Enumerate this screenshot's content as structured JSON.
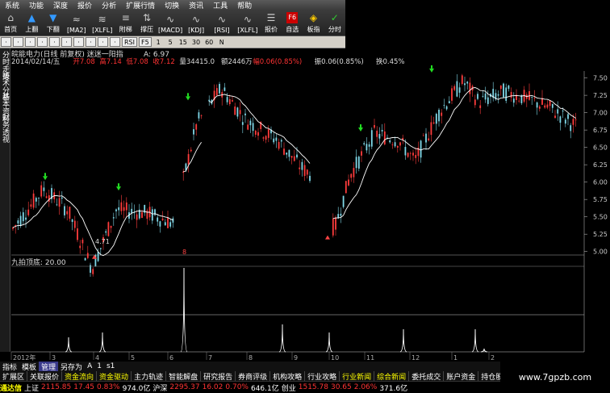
{
  "menubar": {
    "items": [
      "系统",
      "功能",
      "深度",
      "报价",
      "分析",
      "扩展行情",
      "切换",
      "资讯",
      "工具",
      "帮助"
    ]
  },
  "toolbar": {
    "buttons": [
      {
        "label": "首页",
        "icon": "home-icon"
      },
      {
        "label": "上翻",
        "icon": "arrow-up-icon"
      },
      {
        "label": "下翻",
        "icon": "arrow-down-icon"
      },
      {
        "label": "[MA2]",
        "icon": "ma-icon"
      },
      {
        "label": "[XLFL]",
        "icon": "xlfl-icon"
      },
      {
        "label": "附梯",
        "icon": "ladder-icon"
      },
      {
        "label": "撑压",
        "icon": "support-icon"
      },
      {
        "label": "[MACD]",
        "icon": "macd-icon"
      },
      {
        "label": "[KDJ]",
        "icon": "kdj-icon"
      },
      {
        "label": "[RSI]",
        "icon": "rsi-icon"
      },
      {
        "label": "[XLFL]",
        "icon": "xlfl2-icon"
      },
      {
        "label": "报价",
        "icon": "quote-icon"
      },
      {
        "label": "自选",
        "icon": "watchlist-icon"
      },
      {
        "label": "板指",
        "icon": "index-icon"
      },
      {
        "label": "分时",
        "icon": "intraday-icon"
      }
    ]
  },
  "toolbar2": {
    "items": [
      "RSI",
      "F5",
      "1",
      "5",
      "15",
      "30",
      "60",
      "N"
    ]
  },
  "info": {
    "title": "皖能电力(日线 前复权) 迷迷一阳指",
    "a_value": "A: 6.97",
    "date": "2014/02/14/五",
    "open": "开7.08",
    "high": "高7.14",
    "low": "低7.08",
    "close": "收7.12",
    "volume": "量34415.0",
    "amount": "额2446万",
    "change": "幅0.06(0.85%)",
    "amp": "振0.06(0.85%)",
    "turnover": "换0.45%"
  },
  "leftpanel": {
    "tabs": [
      "分时走势",
      "技术分析",
      "基本资料",
      "财务透视"
    ]
  },
  "chart_data": {
    "type": "line",
    "price_axis": [
      7.5,
      7.25,
      7.0,
      6.75,
      6.5,
      6.25,
      6.0,
      5.75,
      5.5,
      5.25,
      5.0
    ],
    "min_label": "4.71",
    "x_labels": [
      "2012年",
      "3",
      "4",
      "5",
      "6",
      "7",
      "8",
      "9",
      "10",
      "11",
      "12",
      "1",
      "2"
    ],
    "indicator_label": "九拍顶底: 20.00",
    "peaks": [
      "8"
    ]
  },
  "bottomtabs": {
    "items": [
      "指标",
      "模板",
      "管理",
      "另存为",
      "A",
      "1",
      "s1"
    ],
    "active": 2
  },
  "footer": {
    "items": [
      "扩展区",
      "关联报价",
      "资金流向",
      "资金驱动",
      "主力轨迹",
      "智能解盘",
      "研究报告",
      "券商评级",
      "机构攻略",
      "行业攻略",
      "行业新闻",
      "综合新闻",
      "委托成交",
      "账户资金",
      "持仓股份"
    ]
  },
  "status": {
    "app": "通达信",
    "index1_name": "上证",
    "index1_value": "2115.85",
    "index1_change": "17.45",
    "index1_pct": "0.83%",
    "index1_amount": "974.0亿",
    "index2_name": "沪深",
    "index2_value": "2295.37",
    "index2_change": "16.02",
    "index2_pct": "0.70%",
    "index2_amount": "646.1亿",
    "index3_name": "创业",
    "index3_value": "1515.78",
    "index3_change": "30.65",
    "index3_pct": "2.06%",
    "index3_amount": "371.6亿"
  },
  "watermark": "www.7gpzb.com"
}
